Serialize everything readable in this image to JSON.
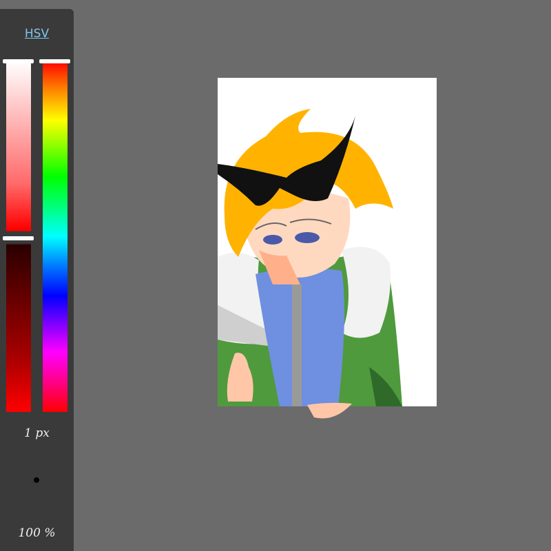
{
  "toolbar": {
    "mode_label": "HSV",
    "brush_size_label": "1 px",
    "opacity_label": "100 %"
  },
  "colors": {
    "selected_hue": "#ff0000",
    "panel_bg": "#3a3a3a",
    "workspace_bg": "#6b6b6b",
    "mode_link": "#7fc6ef"
  },
  "icons": {
    "brush_preview": "brush-dot-icon"
  }
}
